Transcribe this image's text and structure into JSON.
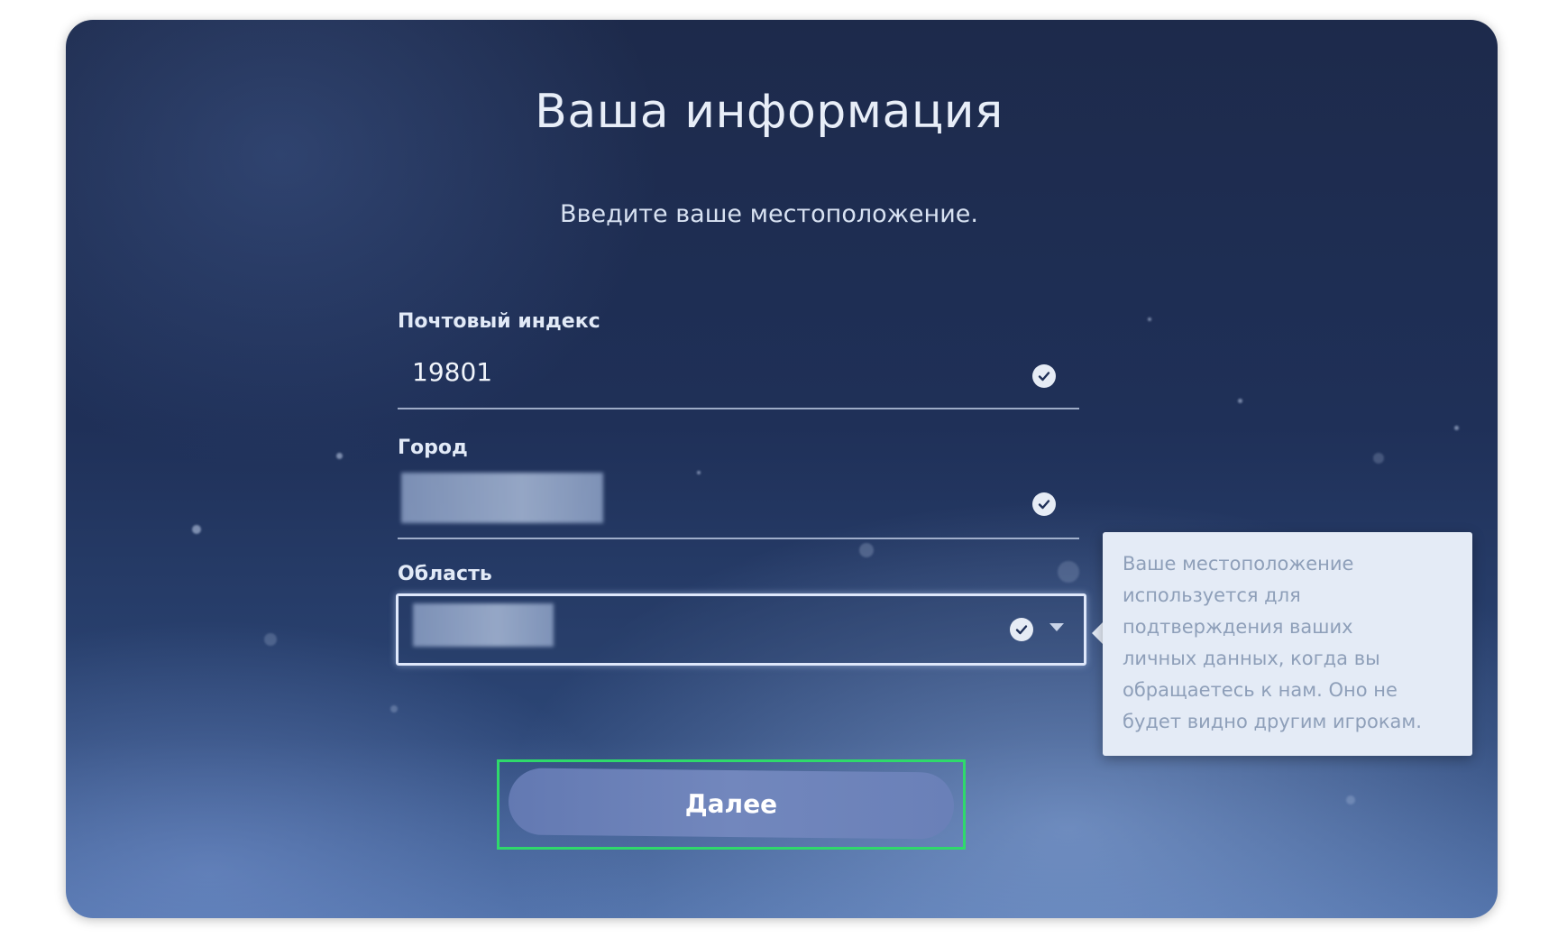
{
  "screen": {
    "title": "Ваша информация",
    "subtitle": "Введите ваше местоположение."
  },
  "form": {
    "postal_code": {
      "label": "Почтовый индекс",
      "value": "19801",
      "status_icon": "check-circle-icon"
    },
    "city": {
      "label": "Город",
      "value_state": "blurred",
      "status_icon": "check-circle-icon"
    },
    "region": {
      "label": "Область",
      "value_state": "blurred",
      "status_icon": "check-circle-icon",
      "dropdown_icon": "chevron-down-icon"
    }
  },
  "tooltip": {
    "lines": [
      "Ваше местоположение",
      "используется для",
      "подтверждения ваших",
      "личных данных, когда вы",
      "обращаетесь к нам. Оно не",
      "будет видно другим игрокам."
    ]
  },
  "actions": {
    "next_label": "Далее",
    "highlight_color": "#2fd96b"
  },
  "colors": {
    "background_top": "#1d2a4b",
    "background_bottom": "#4d6ea6",
    "button": "#6a80b8",
    "tooltip_bg": "#e4ebf6"
  }
}
